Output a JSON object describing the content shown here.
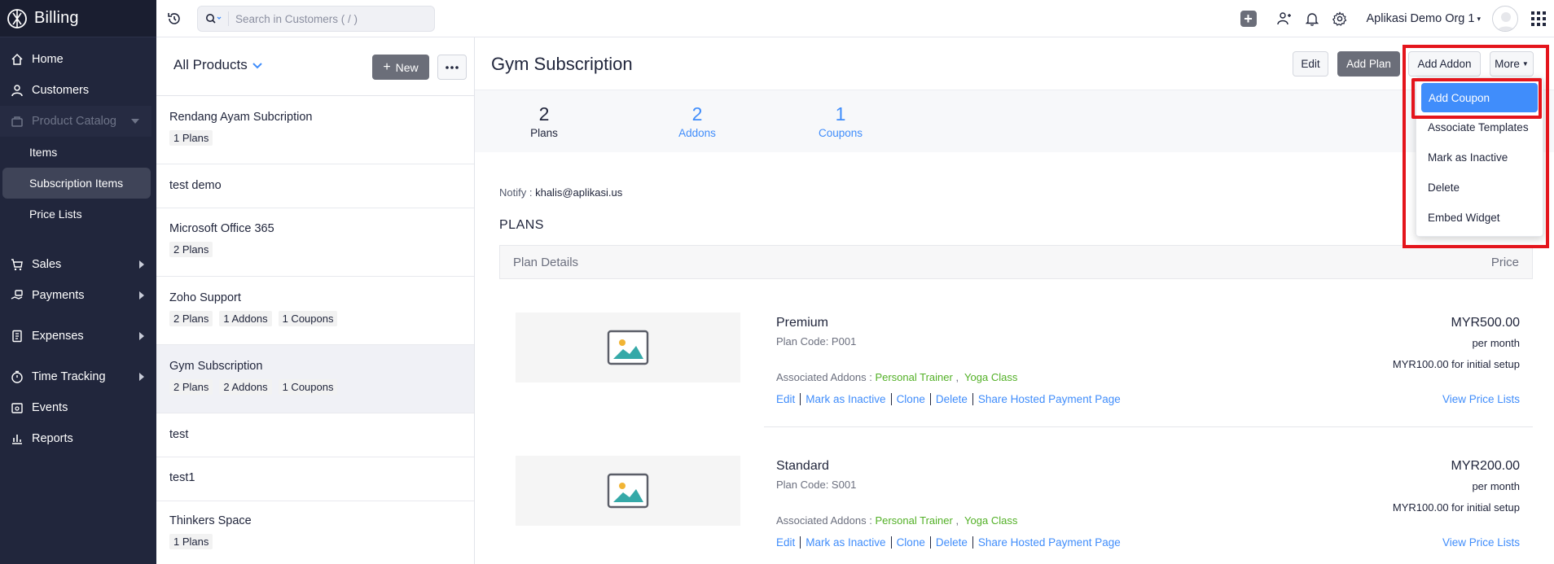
{
  "sidebar": {
    "brand": "Billing",
    "items": [
      {
        "label": "Home",
        "icon": "home-icon"
      },
      {
        "label": "Customers",
        "icon": "user-icon"
      },
      {
        "label": "Product Catalog",
        "icon": "bag-icon"
      }
    ],
    "catalog_sub": [
      "Items",
      "Subscription Items",
      "Price Lists"
    ],
    "sections": [
      {
        "label": "Sales",
        "icon": "cart-icon"
      },
      {
        "label": "Payments",
        "icon": "payments-icon"
      },
      {
        "label": "Expenses",
        "icon": "receipt-icon"
      },
      {
        "label": "Time Tracking",
        "icon": "timer-icon"
      },
      {
        "label": "Events",
        "icon": "calendar-icon"
      },
      {
        "label": "Reports",
        "icon": "bar-chart-icon"
      }
    ]
  },
  "topbar": {
    "search_placeholder": "Search in Customers ( / )",
    "org_name": "Aplikasi Demo Org 1"
  },
  "list": {
    "title": "All Products",
    "new_label": "New",
    "products": [
      {
        "name": "Rendang Ayam Subcription",
        "tags": [
          "1 Plans"
        ]
      },
      {
        "name": "test demo",
        "tags": []
      },
      {
        "name": "Microsoft Office 365",
        "tags": [
          "2 Plans"
        ]
      },
      {
        "name": "Zoho Support",
        "tags": [
          "2 Plans",
          "1 Addons",
          "1 Coupons"
        ]
      },
      {
        "name": "Gym Subscription",
        "tags": [
          "2 Plans",
          "2 Addons",
          "1 Coupons"
        ]
      },
      {
        "name": "test",
        "tags": []
      },
      {
        "name": "test1",
        "tags": []
      },
      {
        "name": "Thinkers Space",
        "tags": [
          "1 Plans"
        ]
      }
    ]
  },
  "detail": {
    "title": "Gym Subscription",
    "buttons": {
      "edit": "Edit",
      "add_plan": "Add Plan",
      "add_addon": "Add Addon",
      "more": "More"
    },
    "stats": [
      {
        "num": "2",
        "label": "Plans"
      },
      {
        "num": "2",
        "label": "Addons"
      },
      {
        "num": "1",
        "label": "Coupons"
      }
    ],
    "notify_label": "Notify :",
    "notify_email": "khalis@aplikasi.us",
    "plans_heading": "PLANS",
    "table_header": {
      "left": "Plan Details",
      "right": "Price"
    },
    "plans": [
      {
        "name": "Premium",
        "code": "Plan Code: P001",
        "addons_label": "Associated Addons :",
        "addon1": "Personal Trainer",
        "addon2": "Yoga Class",
        "price": "MYR500.00",
        "per": "per month",
        "setup": "MYR100.00 for initial setup"
      },
      {
        "name": "Standard",
        "code": "Plan Code: S001",
        "addons_label": "Associated Addons :",
        "addon1": "Personal Trainer",
        "addon2": "Yoga Class",
        "price": "MYR200.00",
        "per": "per month",
        "setup": "MYR100.00 for initial setup"
      }
    ],
    "plan_actions": [
      "Edit",
      "Mark as Inactive",
      "Clone",
      "Delete",
      "Share Hosted Payment Page"
    ],
    "view_price_lists": "View Price Lists"
  },
  "dropdown": {
    "items": [
      "Add Coupon",
      "Associate Templates",
      "Mark as Inactive",
      "Delete",
      "Embed Widget"
    ]
  },
  "colors": {
    "sidebar": "#21263c",
    "accent": "#408dfb",
    "addon_green": "#52b026",
    "highlight": "#e4151c"
  }
}
